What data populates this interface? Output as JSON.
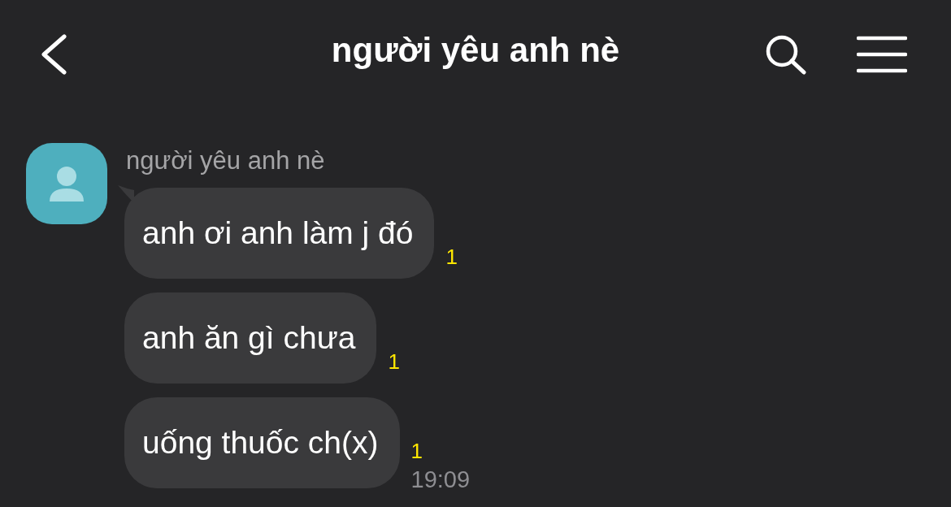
{
  "header": {
    "title": "người yêu anh nè"
  },
  "sender": {
    "name": "người yêu anh nè"
  },
  "messages": [
    {
      "text": "anh ơi anh làm j đó",
      "unread": "1"
    },
    {
      "text": "anh ăn gì chưa",
      "unread": "1"
    },
    {
      "text": "uống thuốc ch(x)",
      "unread": "1",
      "time": "19:09"
    }
  ]
}
